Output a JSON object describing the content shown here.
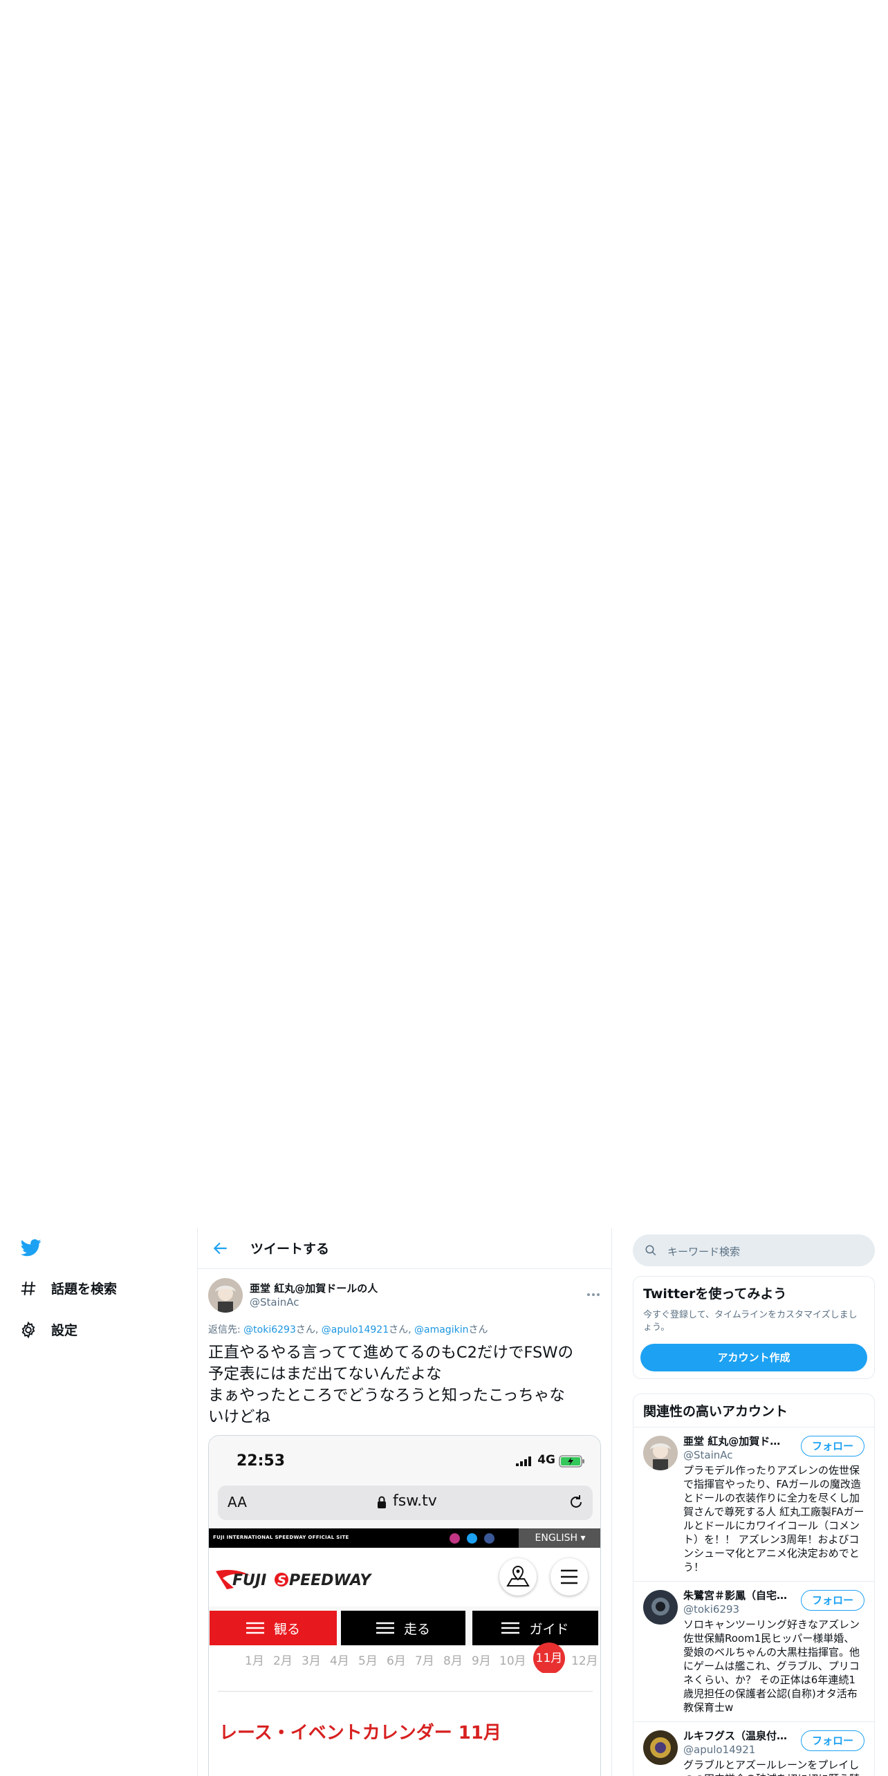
{
  "nav": {
    "items": [
      {
        "label": "話題を検索",
        "icon": "hashtag-icon"
      },
      {
        "label": "設定",
        "icon": "gear-icon"
      }
    ]
  },
  "header": {
    "title": "ツイートする"
  },
  "tweet": {
    "author_name": "亜堂 紅丸@加賀ドールの人",
    "author_handle": "@StainAc",
    "reply_prefix": "返信先: ",
    "mentions": [
      "@toki6293",
      "@apulo14921",
      "@amagikin"
    ],
    "mention_suffix": "さん",
    "text_line1": "正直やるやる言ってて進めてるのもC2だけでFSWの",
    "text_line2": "予定表にはまだ出てないんだよな",
    "text_line3": "まぁやったところでどうなろうと知ったこっちゃな",
    "text_line4": "いけどね"
  },
  "screenshot": {
    "time": "22:53",
    "network": "4G",
    "url_aa": "AA",
    "url": "fsw.tv",
    "official_site": "FUJI INTERNATIONAL SPEEDWAY OFFICIAL SITE",
    "language": "ENGLISH ▾",
    "logo_text": "FUJI SPEEDWAY",
    "tabs": [
      "観る",
      "走る",
      "ガイド"
    ],
    "months": [
      "1月",
      "2月",
      "3月",
      "4月",
      "5月",
      "6月",
      "7月",
      "8月",
      "9月",
      "10月",
      "11月",
      "12月"
    ],
    "active_month": "11月",
    "calendar_title": "レース・イベントカレンダー  11月"
  },
  "search": {
    "placeholder": "キーワード検索"
  },
  "signup_card": {
    "title": "Twitterを使ってみよう",
    "subtitle": "今すぐ登録して、タイムラインをカスタマイズしましょう。",
    "button": "アカウント作成"
  },
  "related": {
    "title": "関連性の高いアカウント",
    "follow_label": "フォロー",
    "accounts": [
      {
        "name": "亜堂 紅丸@加賀ドールの人",
        "handle": "@StainAc",
        "bio": "プラモデル作ったりアズレンの佐世保で指揮官やったり、FAガールの魔改造とドールの衣装作りに全力を尽くし加賀さんで尊死する人 紅丸工廠製FAガールとドールにカワイイコール（コメント）を！！ アズレン3周年！およびコンシューマ化とアニメ化決定おめでとう！"
      },
      {
        "name": "朱鷺宮＃影鳳（自宅警備中）",
        "handle": "@toki6293",
        "bio": "ソロキャンツーリング好きなアズレン佐世保鯖Room1民ヒッパー様単婚、愛娘のベルちゃんの大黒柱指揮官。他にゲームは艦これ、グラブル、プリコネくらい、か？ その正体は6年連続1歳児担任の保護者公認(自称)オタ活布教保育士w"
      },
      {
        "name": "ルキフグス（温泉付きカーズ）",
        "handle": "@apulo14921",
        "bio": "グラブルとアズールレーンをプレイしつつ田中謙介の破滅を切に切に願う騎"
      }
    ]
  },
  "colors": {
    "twitter_blue": "#1da1f2",
    "mention_blue": "#1b95e0",
    "fsw_red": "#e8191e"
  }
}
